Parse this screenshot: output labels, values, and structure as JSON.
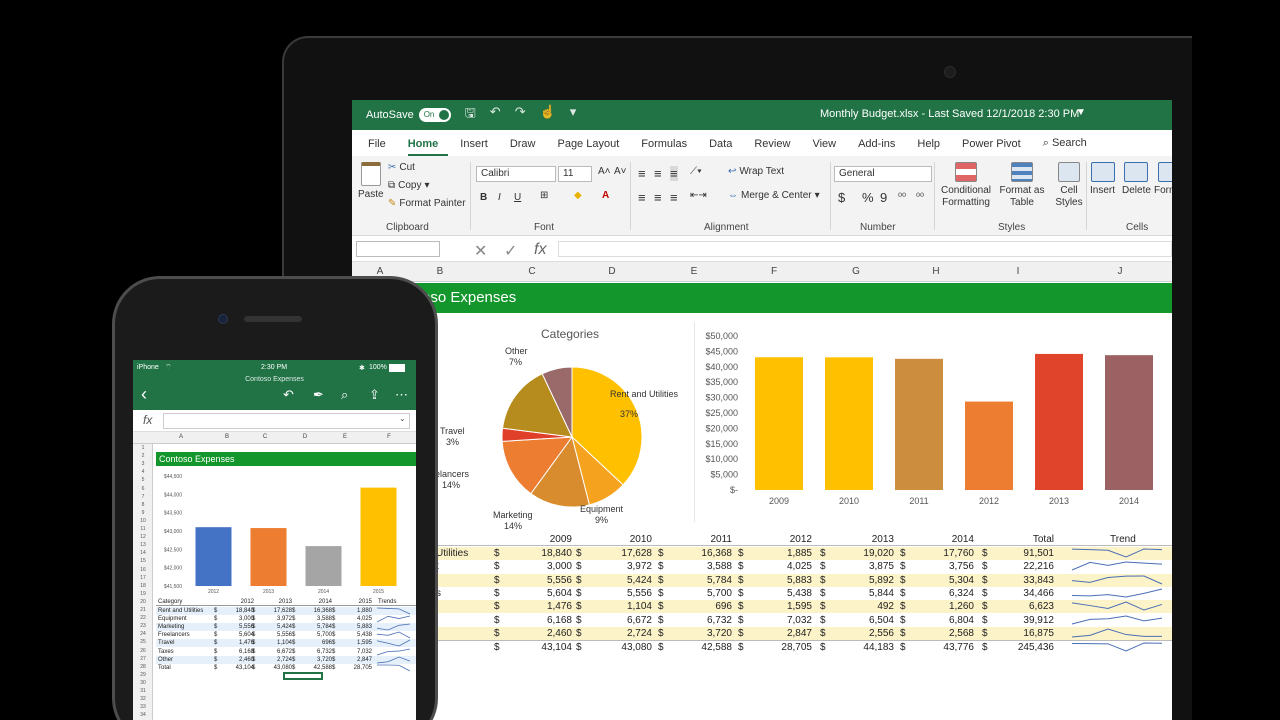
{
  "laptop": {
    "titlebar": {
      "autosave_label": "AutoSave",
      "toggle_state": "On",
      "document_title": "Monthly Budget.xlsx - Last Saved 12/1/2018 2:30 PM"
    },
    "tabs": [
      "File",
      "Home",
      "Insert",
      "Draw",
      "Page Layout",
      "Formulas",
      "Data",
      "Review",
      "View",
      "Add-ins",
      "Help",
      "Power Pivot"
    ],
    "search_label": "Search",
    "ribbon": {
      "paste": "Paste",
      "cut": "Cut",
      "copy": "Copy",
      "format_painter": "Format Painter",
      "clipboard": "Clipboard",
      "font_name": "Calibri",
      "font_size": "11",
      "bold": "B",
      "italic": "I",
      "underline": "U",
      "font": "Font",
      "wrap_text": "Wrap Text",
      "merge_center": "Merge & Center",
      "alignment": "Alignment",
      "number_format": "General",
      "number": "Number",
      "currency": "$",
      "percent": "%",
      "comma": "9",
      "conditional_formatting": "Conditional Formatting",
      "format_as_table": "Format as Table",
      "cell_styles": "Cell Styles",
      "styles": "Styles",
      "insert": "Insert",
      "delete": "Delete",
      "format": "Form",
      "cells": "Cells"
    },
    "formula_bar": {
      "fx": "fx"
    },
    "columns": [
      "A",
      "B",
      "C",
      "D",
      "E",
      "F",
      "G",
      "H",
      "I",
      "J"
    ],
    "sheet_title": "oso Expenses",
    "pie": {
      "title": "Categories",
      "labels": [
        {
          "name": "Rent and Utilities",
          "pct": "37%"
        },
        {
          "name": "Equipment",
          "pct": "9%"
        },
        {
          "name": "Marketing",
          "pct": "14%"
        },
        {
          "name": "eelancers",
          "pct": "14%"
        },
        {
          "name": "Travel",
          "pct": "3%"
        },
        {
          "name": "Other",
          "pct": "7%"
        }
      ]
    },
    "table": {
      "headers": [
        "2009",
        "2010",
        "2011",
        "2012",
        "2013",
        "2014",
        "Total",
        "Trend"
      ],
      "rows": [
        {
          "label": "Utilities",
          "vals": [
            "18,840",
            "17,628",
            "16,368",
            "1,885",
            "19,020",
            "17,760",
            "91,501"
          ]
        },
        {
          "label": "t",
          "vals": [
            "3,000",
            "3,972",
            "3,588",
            "4,025",
            "3,875",
            "3,756",
            "22,216"
          ]
        },
        {
          "label": "",
          "vals": [
            "5,556",
            "5,424",
            "5,784",
            "5,883",
            "5,892",
            "5,304",
            "33,843"
          ]
        },
        {
          "label": "s",
          "vals": [
            "5,604",
            "5,556",
            "5,700",
            "5,438",
            "5,844",
            "6,324",
            "34,466"
          ]
        },
        {
          "label": "",
          "vals": [
            "1,476",
            "1,104",
            "696",
            "1,595",
            "492",
            "1,260",
            "6,623"
          ]
        },
        {
          "label": "",
          "vals": [
            "6,168",
            "6,672",
            "6,732",
            "7,032",
            "6,504",
            "6,804",
            "39,912"
          ]
        },
        {
          "label": "",
          "vals": [
            "2,460",
            "2,724",
            "3,720",
            "2,847",
            "2,556",
            "2,568",
            "16,875"
          ]
        },
        {
          "label": "",
          "vals": [
            "43,104",
            "43,080",
            "42,588",
            "28,705",
            "44,183",
            "43,776",
            "245,436"
          ]
        }
      ]
    }
  },
  "phone": {
    "status": {
      "carrier": "iPhone",
      "time": "2:30 PM",
      "battery": "100%"
    },
    "title": "Contoso Expenses",
    "fx": "fx",
    "columns": [
      "A",
      "B",
      "C",
      "D",
      "E",
      "F"
    ],
    "sheet_title": "Contoso Expenses",
    "row_numbers": [
      "1",
      "2",
      "3",
      "4",
      "5",
      "6",
      "7",
      "8",
      "9",
      "10",
      "11",
      "12",
      "13",
      "14",
      "15",
      "16",
      "17",
      "18",
      "19",
      "20",
      "21",
      "22",
      "23",
      "24",
      "25",
      "26",
      "27",
      "28",
      "29",
      "30",
      "31",
      "32",
      "33",
      "34"
    ],
    "table": {
      "headers": [
        "Category",
        "2012",
        "2013",
        "2014",
        "2015",
        "Trends"
      ],
      "rows": [
        {
          "label": "Rent and Utilities",
          "vals": [
            "18,840",
            "17,628",
            "16,368",
            "1,880"
          ]
        },
        {
          "label": "Equipment",
          "vals": [
            "3,000",
            "3,972",
            "3,588",
            "4,025"
          ]
        },
        {
          "label": "Marketing",
          "vals": [
            "5,556",
            "5,424",
            "5,784",
            "5,883"
          ]
        },
        {
          "label": "Freelancers",
          "vals": [
            "5,604",
            "5,556",
            "5,700",
            "5,438"
          ]
        },
        {
          "label": "Travel",
          "vals": [
            "1,476",
            "1,104",
            "696",
            "1,595"
          ]
        },
        {
          "label": "Taxes",
          "vals": [
            "6,168",
            "6,672",
            "6,732",
            "7,032"
          ]
        },
        {
          "label": "Other",
          "vals": [
            "2,460",
            "2,724",
            "3,720",
            "2,847"
          ]
        },
        {
          "label": "Total",
          "vals": [
            "43,104",
            "43,080",
            "42,588",
            "28,705"
          ]
        }
      ]
    }
  },
  "chart_data": [
    {
      "type": "pie",
      "title": "Categories",
      "categories": [
        "Rent and Utilities",
        "Equipment",
        "Marketing",
        "Freelancers",
        "Travel",
        "Other"
      ],
      "values": [
        37,
        9,
        14,
        14,
        3,
        7
      ],
      "colors": [
        "#ffc000",
        "#f5a21f",
        "#d88c2e",
        "#ed7d31",
        "#e0402a",
        "#9a6a6a",
        "#b78c1e"
      ]
    },
    {
      "type": "bar",
      "categories": [
        "2009",
        "2010",
        "2011",
        "2012",
        "2013",
        "2014"
      ],
      "values": [
        43104,
        43080,
        42588,
        28705,
        44183,
        43776
      ],
      "colors": [
        "#ffc000",
        "#ffc000",
        "#cd8d3f",
        "#ed7d31",
        "#e0442a",
        "#9c6162"
      ],
      "ylim": [
        0,
        50000
      ],
      "yticks": [
        "$50,000",
        "$45,000",
        "$40,000",
        "$35,000",
        "$30,000",
        "$25,000",
        "$20,000",
        "$15,000",
        "$10,000",
        "$5,000",
        "$-"
      ]
    },
    {
      "type": "bar",
      "categories": [
        "2012",
        "2013",
        "2014",
        "2015"
      ],
      "values": [
        43104,
        43080,
        42588,
        44183
      ],
      "colors": [
        "#4472c4",
        "#ed7d31",
        "#a5a5a5",
        "#ffc000"
      ],
      "ylim": [
        41500,
        44500
      ],
      "yticks": [
        "$44,500",
        "$44,000",
        "$43,500",
        "$43,000",
        "$42,500",
        "$42,000",
        "$41,500"
      ]
    }
  ],
  "colors": {
    "excel_green": "#217346",
    "banner_green": "#13972c",
    "row_highlight": "#fdf3c8"
  }
}
